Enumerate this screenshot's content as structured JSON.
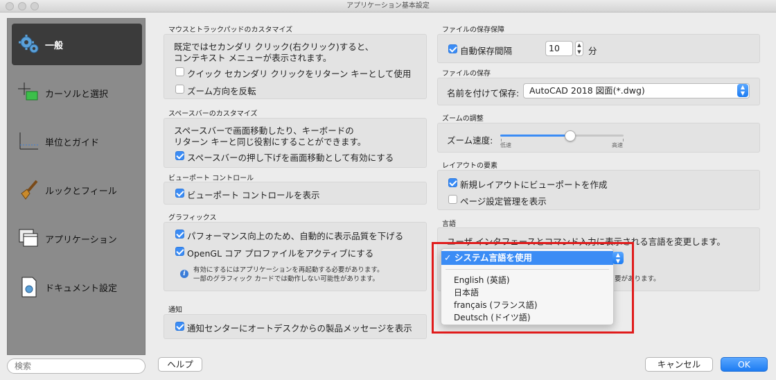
{
  "window": {
    "title": "アプリケーション基本設定"
  },
  "sidebar": {
    "items": [
      {
        "label": "一般",
        "icon": "gear-icon",
        "active": true
      },
      {
        "label": "カーソルと選択",
        "icon": "cursor-select-icon"
      },
      {
        "label": "単位とガイド",
        "icon": "units-guides-icon"
      },
      {
        "label": "ルックとフィール",
        "icon": "brush-icon"
      },
      {
        "label": "アプリケーション",
        "icon": "windows-icon"
      },
      {
        "label": "ドキュメント設定",
        "icon": "document-settings-icon"
      }
    ],
    "search_placeholder": "検索"
  },
  "left": {
    "mouse": {
      "title": "マウスとトラックパッドのカスタマイズ",
      "desc1": "既定ではセカンダリ クリック(右クリック)すると、",
      "desc2": "コンテキスト メニューが表示されます。",
      "opt1": "クイック セカンダリ クリックをリターン キーとして使用",
      "opt2": "ズーム方向を反転"
    },
    "space": {
      "title": "スペースバーのカスタマイズ",
      "desc1": "スペースバーで画面移動したり、キーボードの",
      "desc2": "リターン キーと同じ役割にすることができます。",
      "opt1": "スペースバーの押し下げを画面移動として有効にする"
    },
    "viewport": {
      "title": "ビューポート コントロール",
      "opt1": "ビューポート コントロールを表示"
    },
    "graphics": {
      "title": "グラフィックス",
      "opt1": "パフォーマンス向上のため、自動的に表示品質を下げる",
      "opt2": "OpenGL コア プロファイルをアクティブにする",
      "note1": "有効にするにはアプリケーションを再起動する必要があります。",
      "note2": "一部のグラフィック カードでは動作しない可能性があります。"
    },
    "notify": {
      "title": "通知",
      "opt1": "通知センターにオートデスクからの製品メッセージを表示"
    }
  },
  "right": {
    "autosave": {
      "title": "ファイルの保存保障",
      "label": "自動保存間隔",
      "value": "10",
      "unit": "分"
    },
    "save": {
      "title": "ファイルの保存",
      "label": "名前を付けて保存:",
      "value": "AutoCAD 2018 図面(*.dwg)"
    },
    "zoom": {
      "title": "ズームの調整",
      "label": "ズーム速度:",
      "low": "低速",
      "high": "高速",
      "level": 0.57
    },
    "layout": {
      "title": "レイアウトの要素",
      "opt1": "新規レイアウトにビューポートを作成",
      "opt2": "ページ設定管理を表示"
    },
    "language": {
      "title": "言語",
      "desc": "ユーザ インタフェースとコマンド入力に表示される言語を変更します。",
      "note_tail": "要があります。",
      "selected": "システム言語を使用",
      "options": [
        "English (英語)",
        "日本語",
        "français (フランス語)",
        "Deutsch (ドイツ語)"
      ]
    }
  },
  "footer": {
    "help": "ヘルプ",
    "cancel": "キャンセル",
    "ok": "OK"
  },
  "colors": {
    "accent": "#3b8cf5",
    "highlight_border": "#e01b1b",
    "sidebar": "#8b8b8b"
  }
}
